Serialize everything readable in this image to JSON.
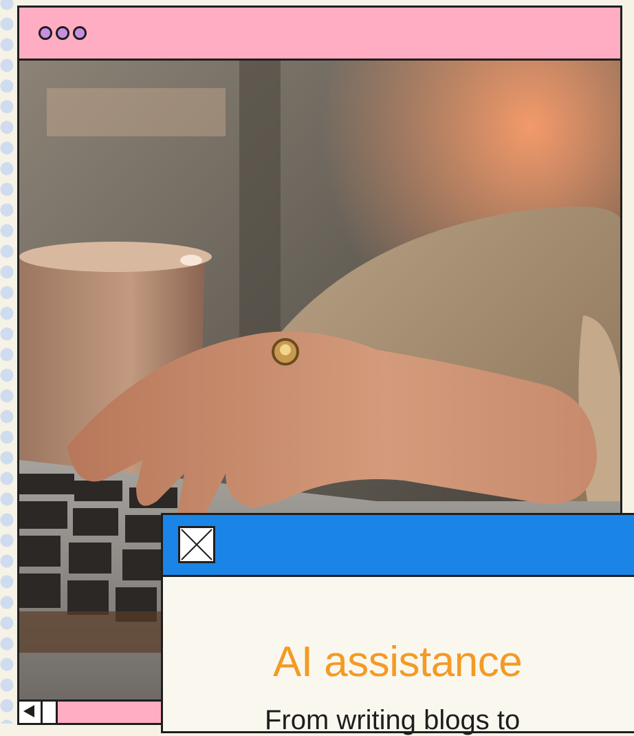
{
  "window": {
    "title_lights": [
      "purple",
      "purple",
      "purple"
    ],
    "photo_description_icon": "woman-typing-laptop-image"
  },
  "dialog": {
    "close_icon": "close-icon",
    "heading": "AI assistance",
    "subtext": "From writing blogs to"
  },
  "colors": {
    "titlebar": "#ffadc3",
    "lights": "#c98ee0",
    "dialog_bar": "#1a85e6",
    "heading": "#f49a25",
    "background": "#f6f3e6"
  }
}
